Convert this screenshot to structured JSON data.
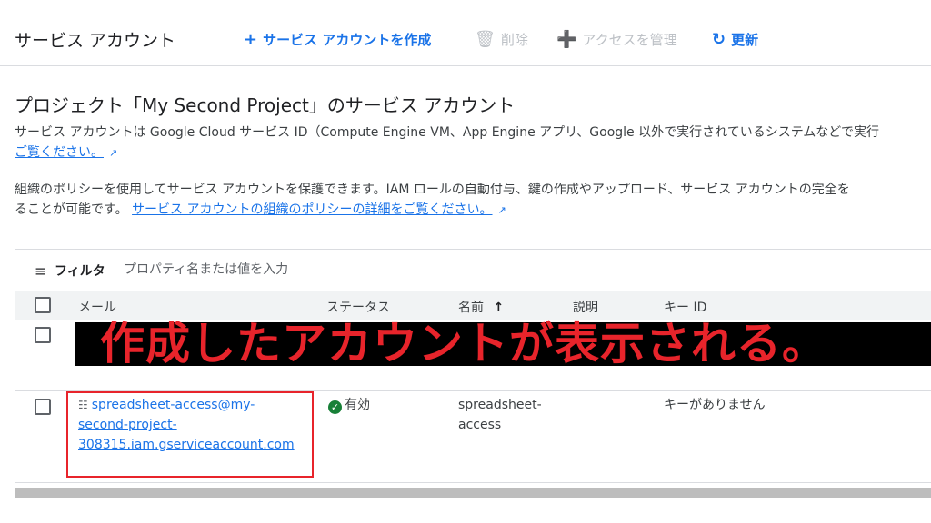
{
  "header": {
    "title": "サービス アカウント",
    "create_label": "サービス アカウントを作成",
    "delete_label": "削除",
    "access_label": "アクセスを管理",
    "refresh_label": "更新"
  },
  "section": {
    "title": "プロジェクト「My Second Project」のサービス アカウント",
    "desc1": "サービス アカウントは Google Cloud サービス ID（Compute Engine VM、App Engine アプリ、Google 以外で実行されているシステムなどで実行",
    "desc1_link": "ご覧ください。",
    "desc2": "組織のポリシーを使用してサービス アカウントを保護できます。IAM ロールの自動付与、鍵の作成やアップロード、サービス アカウントの完全を",
    "desc2b": "ることが可能です。",
    "desc2_link": "サービス アカウントの組織のポリシーの詳細をご覧ください。"
  },
  "filter": {
    "label": "フィルタ",
    "placeholder": "プロパティ名または値を入力"
  },
  "table": {
    "columns": [
      "メール",
      "ステータス",
      "名前",
      "説明",
      "キー ID"
    ],
    "sort_arrow": "↑",
    "rows": [
      {
        "email_lines": [
          "spreadsheet-access@my-",
          "second-project-",
          "308315.iam.gserviceaccount.com"
        ],
        "status": "有効",
        "name_lines": [
          "spreadsheet-",
          "access"
        ],
        "description": "",
        "key_id": "キーがありません"
      }
    ],
    "partial_status": "有効"
  },
  "overlay": {
    "caption": "作成したアカウントが表示される。",
    "accent_color": "#e8242b"
  }
}
